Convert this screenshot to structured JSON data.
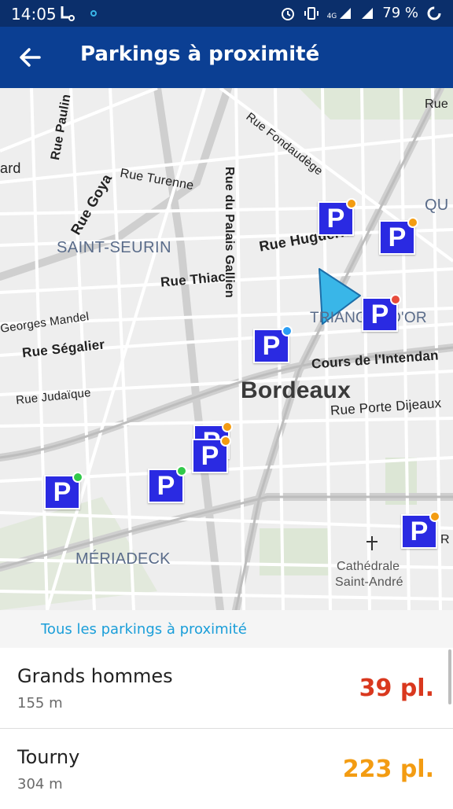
{
  "statusbar": {
    "time": "14:05",
    "battery": "79 %",
    "network": "4G"
  },
  "appbar": {
    "title": "Parkings à proximité"
  },
  "map": {
    "labels": [
      {
        "key": "rue_paulin",
        "text": "Rue Paulin"
      },
      {
        "key": "ard",
        "text": "ard"
      },
      {
        "key": "rue_goya",
        "text": "Rue Goya"
      },
      {
        "key": "rue_turenne",
        "text": "Rue Turenne"
      },
      {
        "key": "rue_fondaudege",
        "text": "Rue Fondaudège"
      },
      {
        "key": "rue_partial",
        "text": "Rue"
      },
      {
        "key": "qu_partial",
        "text": "QU"
      },
      {
        "key": "saint_seurin",
        "text": "SAINT-SEURIN"
      },
      {
        "key": "rue_huguerie",
        "text": "Rue Huguerie"
      },
      {
        "key": "rue_palais_gallien",
        "text": "Rue du Palais Gallien"
      },
      {
        "key": "rue_thiac",
        "text": "Rue Thiac"
      },
      {
        "key": "georges_mandel",
        "text": "Georges Mandel"
      },
      {
        "key": "triangle_or",
        "text": "TRIANGLE D'OR"
      },
      {
        "key": "rue_segalier",
        "text": "Rue Ségalier"
      },
      {
        "key": "cours_intendance",
        "text": "Cours de l'Intendan"
      },
      {
        "key": "bordeaux",
        "text": "Bordeaux"
      },
      {
        "key": "rue_judaique",
        "text": "Rue Judaïque"
      },
      {
        "key": "rue_porte_dijeaux",
        "text": "Rue Porte Dijeaux"
      },
      {
        "key": "meriadeck",
        "text": "MÉRIADECK"
      },
      {
        "key": "cathedrale",
        "text": "Cathédrale"
      },
      {
        "key": "saint_andre",
        "text": "Saint-André"
      },
      {
        "key": "r_partial",
        "text": "R"
      }
    ],
    "parking_glyph": "P",
    "status_colors": {
      "orange": "#f39c12",
      "green": "#32c94a",
      "red": "#e74c3c",
      "blue": "#2a9df4"
    }
  },
  "link": {
    "label": "Tous les parkings à proximité"
  },
  "parkings": [
    {
      "name": "Grands hommes",
      "distance": "155 m",
      "places": "39 pl.",
      "color": "#d9381e"
    },
    {
      "name": "Tourny",
      "distance": "304 m",
      "places": "223 pl.",
      "color": "#f39c12"
    }
  ]
}
